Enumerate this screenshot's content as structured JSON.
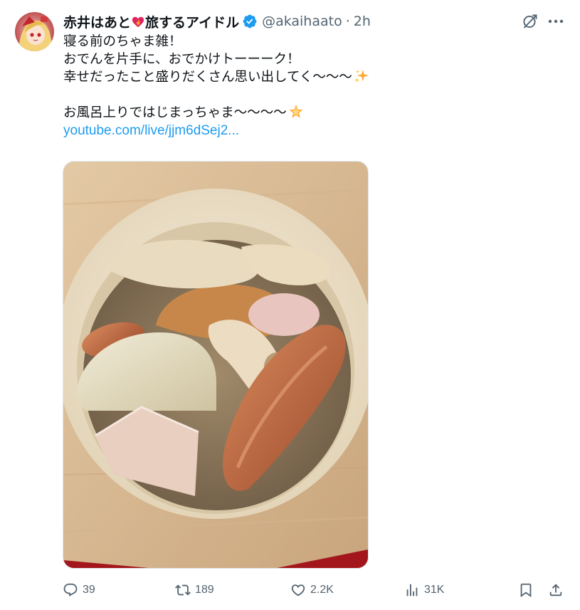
{
  "tweet": {
    "author": {
      "name_part1": "赤井はあと",
      "name_part2": "旅するアイドル",
      "handle": "@akaihaato",
      "time": "2h",
      "separator": "·",
      "verified": true,
      "avatar_icon": "avatar-image"
    },
    "text": {
      "line1": "寝る前のちゃま雑！",
      "line2": "おでんを片手に、おでかけトーーーク！",
      "line3": "幸せだったこと盛りだくさん思い出してく〜〜〜",
      "line5": "お風呂上りではじまっちゃま〜〜〜〜",
      "link": "youtube.com/live/jjm6dSej2..."
    },
    "emoji": {
      "heart": "heart-fire-emoji",
      "sparkles": "sparkles-emoji",
      "star": "glowing-star-emoji"
    },
    "media": {
      "description_icon": "oden-photo"
    },
    "actions": {
      "replies": "39",
      "reposts": "189",
      "likes": "2.2K",
      "views": "31K"
    },
    "icons": {
      "grok": "grok-icon",
      "more": "more-icon",
      "reply": "reply-icon",
      "repost": "repost-icon",
      "like": "heart-icon",
      "views": "views-icon",
      "bookmark": "bookmark-icon",
      "share": "share-icon"
    },
    "colors": {
      "link": "#1d9bf0",
      "secondary_text": "#536471",
      "verified": "#1d9bf0"
    }
  }
}
